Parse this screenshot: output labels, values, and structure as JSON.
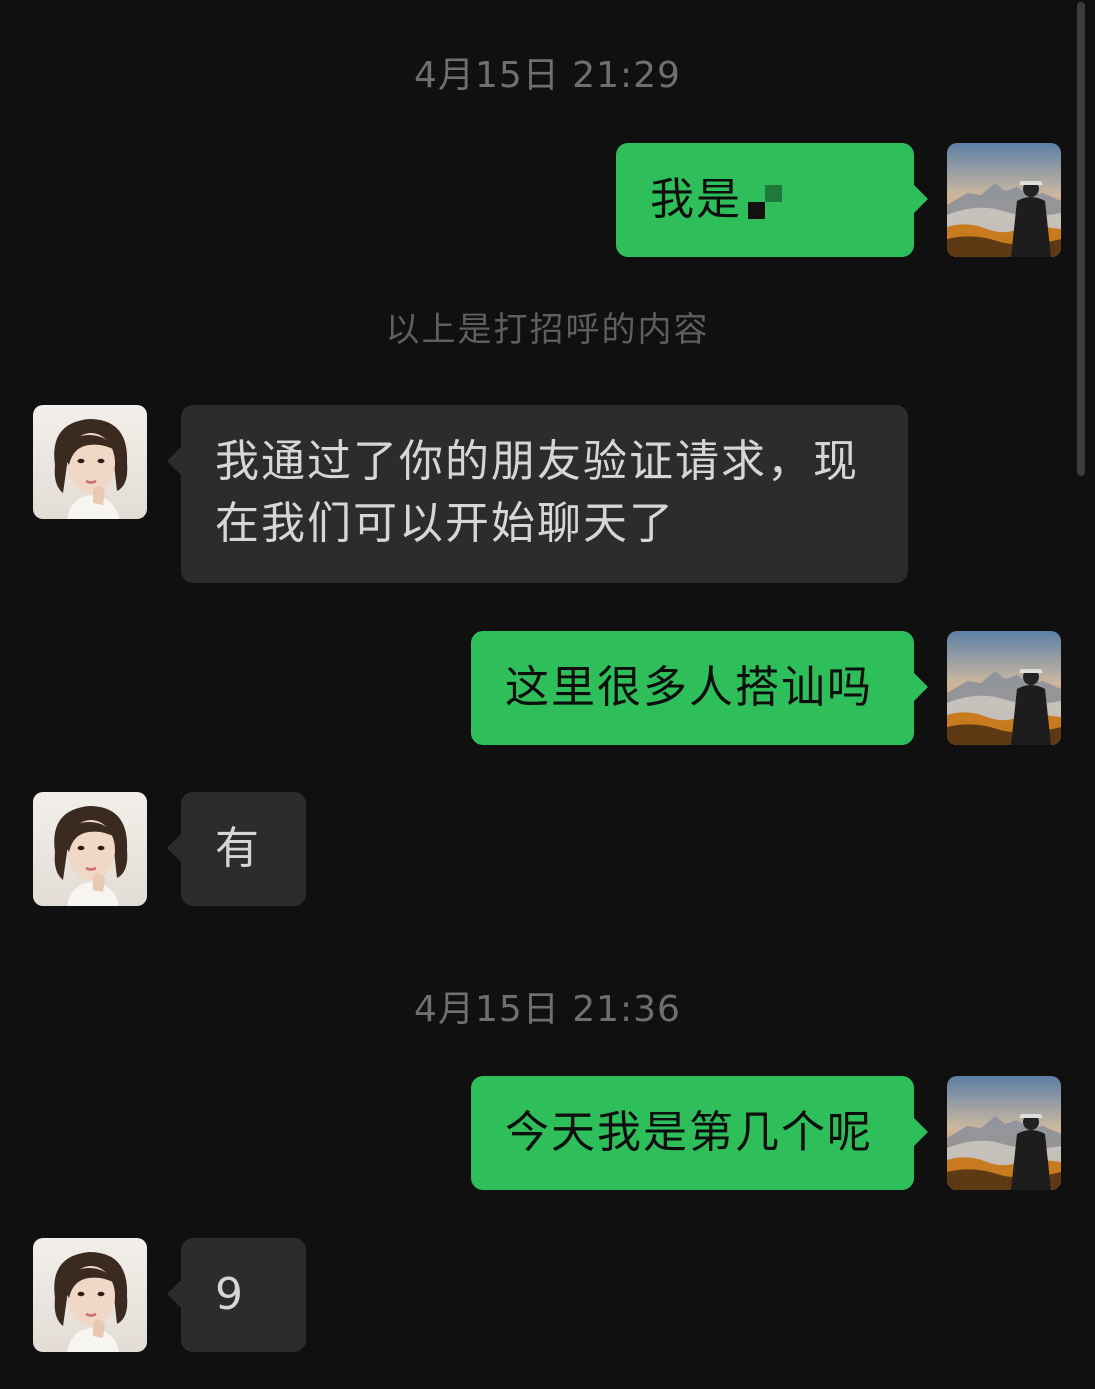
{
  "conversation": {
    "timestamps": [
      "4月15日 21:29",
      "4月15日 21:36"
    ],
    "system_note": "以上是打招呼的内容",
    "messages": [
      {
        "sender": "me",
        "text": "我是"
      },
      {
        "sender": "contact",
        "text": "我通过了你的朋友验证请求，现在我们可以开始聊天了"
      },
      {
        "sender": "me",
        "text": "这里很多人搭讪吗"
      },
      {
        "sender": "contact",
        "text": "有"
      },
      {
        "sender": "me",
        "text": "今天我是第几个呢"
      },
      {
        "sender": "contact",
        "text": "9"
      }
    ]
  },
  "colors": {
    "background": "#101010",
    "outgoing_bubble": "#2fbf5a",
    "incoming_bubble": "#2c2c2c",
    "timestamp_text": "#6f6f6f"
  },
  "icons": {
    "my_avatar": "mountain-sunrise-avatar",
    "contact_avatar": "woman-portrait-avatar"
  }
}
